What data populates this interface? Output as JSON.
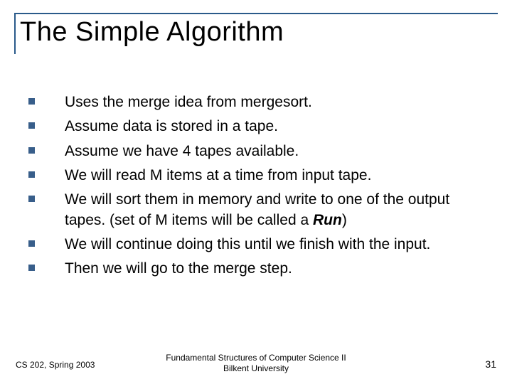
{
  "title": "The Simple Algorithm",
  "bullets": [
    "Uses the merge idea from mergesort.",
    "Assume data is stored in a tape.",
    "Assume we have 4 tapes available.",
    "We will read M items at a time from input tape.",
    "We will sort them in memory and write to one of the output tapes. (set of M items will be called a __RUN__)",
    "We will continue doing this until we finish with the input.",
    "Then we will go to the merge step."
  ],
  "run_word": "Run",
  "footer": {
    "left": "CS 202, Spring 2003",
    "center_line1": "Fundamental Structures of Computer Science II",
    "center_line2": "Bilkent University",
    "right": "31"
  }
}
